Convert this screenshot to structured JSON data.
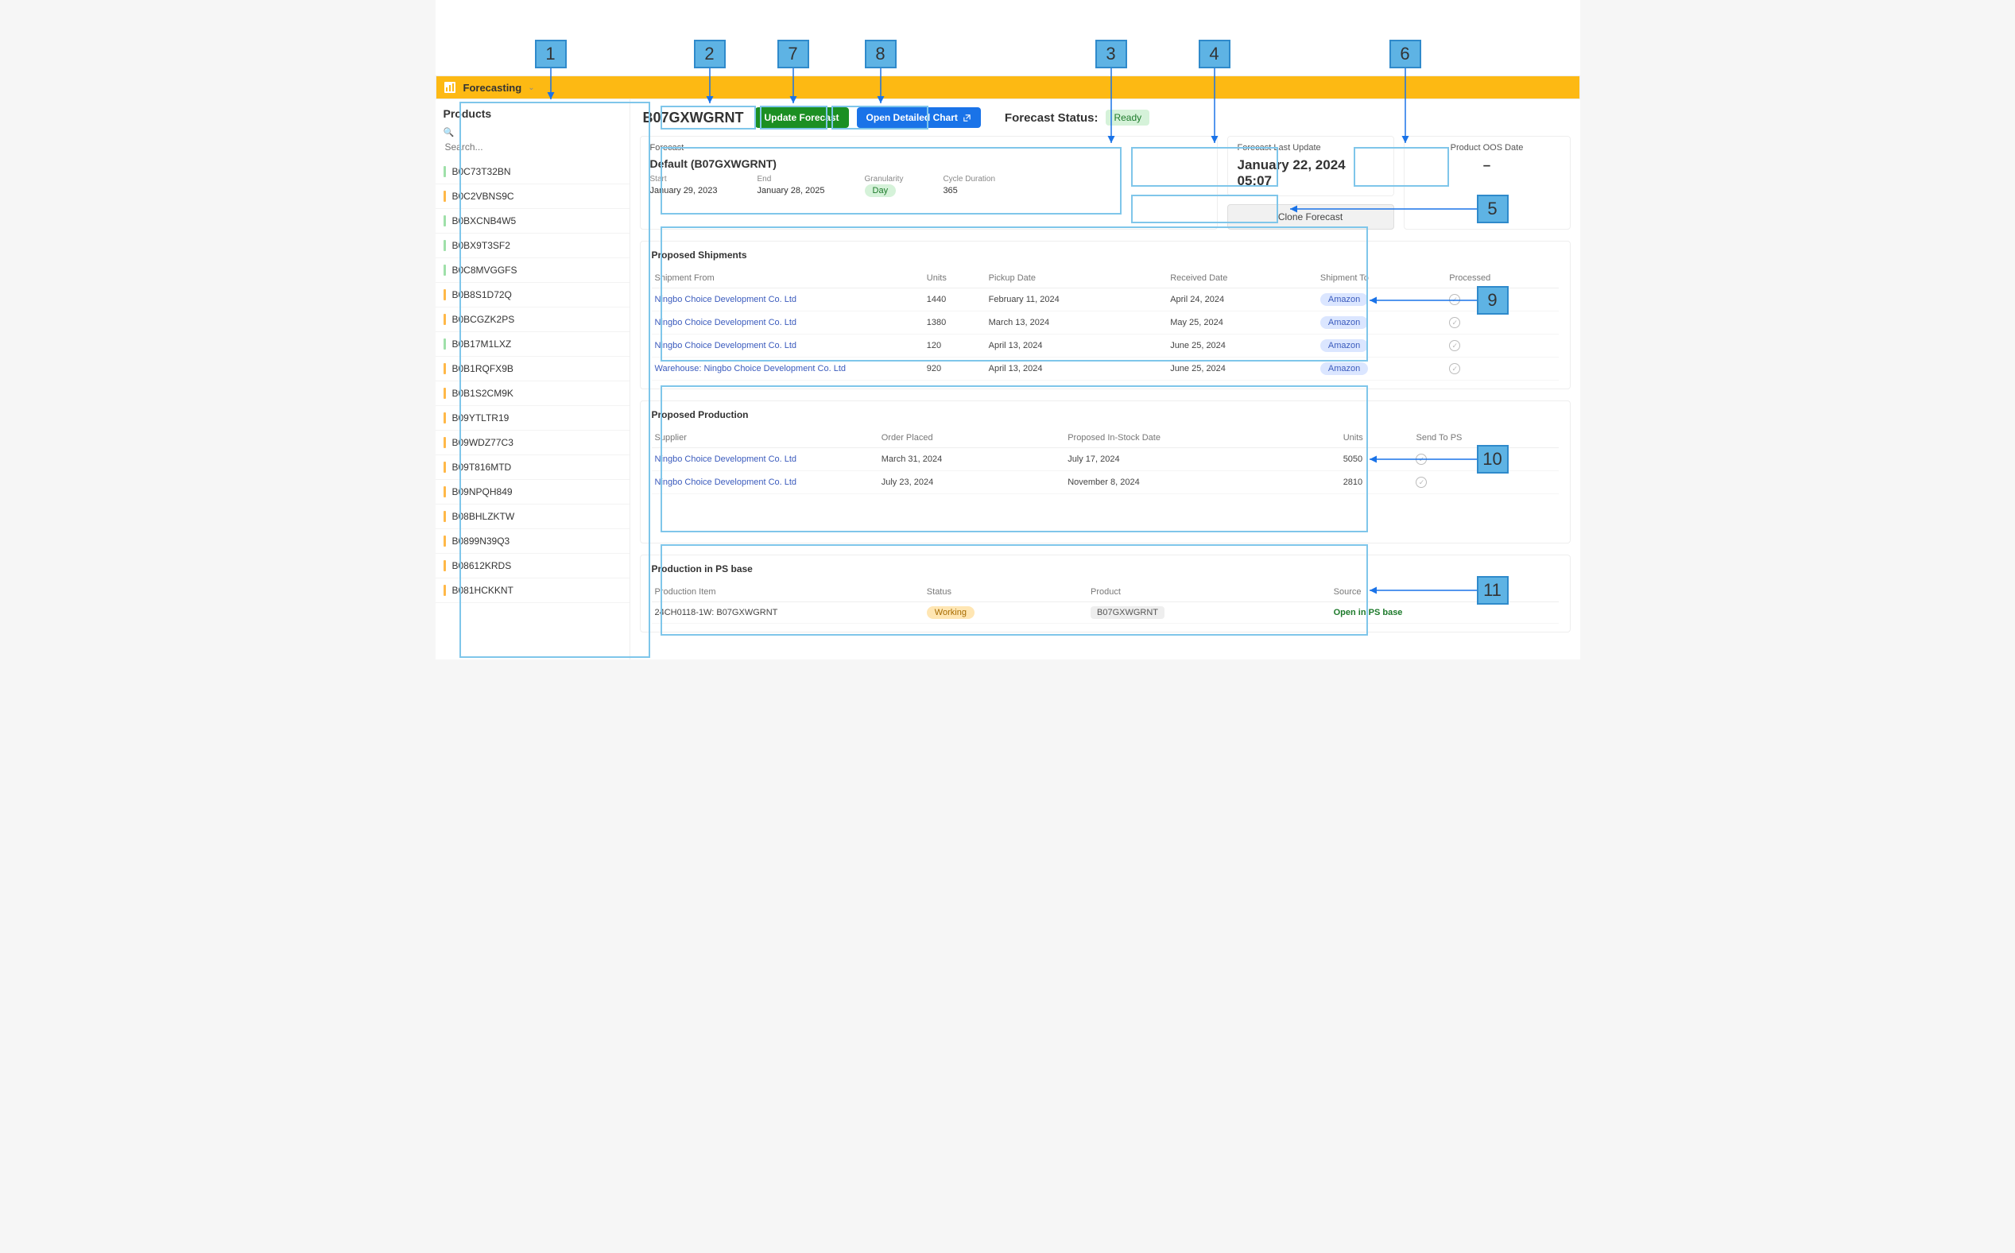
{
  "annotations": {
    "1": "1",
    "2": "2",
    "3": "3",
    "4": "4",
    "5": "5",
    "6": "6",
    "7": "7",
    "8": "8",
    "9": "9",
    "10": "10",
    "11": "11"
  },
  "header": {
    "title": "Forecasting"
  },
  "sidebar": {
    "title": "Products",
    "search_placeholder": "Search...",
    "items": [
      {
        "code": "B0C73T32BN",
        "bar": "green"
      },
      {
        "code": "B0C2VBNS9C",
        "bar": "orange"
      },
      {
        "code": "B0BXCNB4W5",
        "bar": "green"
      },
      {
        "code": "B0BX9T3SF2",
        "bar": "green"
      },
      {
        "code": "B0C8MVGGFS",
        "bar": "green"
      },
      {
        "code": "B0B8S1D72Q",
        "bar": "orange"
      },
      {
        "code": "B0BCGZK2PS",
        "bar": "orange"
      },
      {
        "code": "B0B17M1LXZ",
        "bar": "green"
      },
      {
        "code": "B0B1RQFX9B",
        "bar": "orange"
      },
      {
        "code": "B0B1S2CM9K",
        "bar": "orange"
      },
      {
        "code": "B09YTLTR19",
        "bar": "orange"
      },
      {
        "code": "B09WDZ77C3",
        "bar": "orange"
      },
      {
        "code": "B09T816MTD",
        "bar": "orange"
      },
      {
        "code": "B09NPQH849",
        "bar": "orange"
      },
      {
        "code": "B08BHLZKTW",
        "bar": "orange"
      },
      {
        "code": "B0899N39Q3",
        "bar": "orange"
      },
      {
        "code": "B08612KRDS",
        "bar": "orange"
      },
      {
        "code": "B081HCKKNT",
        "bar": "orange"
      }
    ]
  },
  "toolbar": {
    "sku": "B07GXWGRNT",
    "update_label": "Update Forecast",
    "open_chart_label": "Open Detailed Chart",
    "status_label": "Forecast Status:",
    "status_badge": "Ready"
  },
  "forecast_card": {
    "title": "Forecast",
    "name": "Default (B07GXWGRNT)",
    "start_label": "Start",
    "start": "January 29, 2023",
    "end_label": "End",
    "end": "January 28, 2025",
    "gran_label": "Granularity",
    "gran": "Day",
    "cycle_label": "Cycle Duration",
    "cycle": "365"
  },
  "last_update": {
    "label": "Forecast Last Update",
    "value": "January 22, 2024  05:07"
  },
  "oos": {
    "label": "Product OOS Date",
    "value": "–"
  },
  "clone_label": "Clone Forecast",
  "shipments": {
    "title": "Proposed Shipments",
    "headers": {
      "from": "Shipment From",
      "units": "Units",
      "pickup": "Pickup Date",
      "recv": "Received Date",
      "to": "Shipment To",
      "proc": "Processed"
    },
    "rows": [
      {
        "from": "Ningbo Choice Development Co. Ltd",
        "units": "1440",
        "pickup": "February 11, 2024",
        "recv": "April 24, 2024",
        "to": "Amazon"
      },
      {
        "from": "Ningbo Choice Development Co. Ltd",
        "units": "1380",
        "pickup": "March 13, 2024",
        "recv": "May 25, 2024",
        "to": "Amazon"
      },
      {
        "from": "Ningbo Choice Development Co. Ltd",
        "units": "120",
        "pickup": "April 13, 2024",
        "recv": "June 25, 2024",
        "to": "Amazon"
      },
      {
        "from": "Warehouse: Ningbo Choice Development Co. Ltd",
        "units": "920",
        "pickup": "April 13, 2024",
        "recv": "June 25, 2024",
        "to": "Amazon"
      }
    ]
  },
  "production": {
    "title": "Proposed Production",
    "headers": {
      "supplier": "Supplier",
      "placed": "Order Placed",
      "instock": "Proposed In-Stock Date",
      "units": "Units",
      "send": "Send To PS"
    },
    "rows": [
      {
        "supplier": "Ningbo Choice Development Co. Ltd",
        "placed": "March 31, 2024",
        "instock": "July 17, 2024",
        "units": "5050"
      },
      {
        "supplier": "Ningbo Choice Development Co. Ltd",
        "placed": "July 23, 2024",
        "instock": "November 8, 2024",
        "units": "2810"
      }
    ]
  },
  "psbase": {
    "title": "Production in PS base",
    "headers": {
      "item": "Production Item",
      "status": "Status",
      "product": "Product",
      "source": "Source"
    },
    "rows": [
      {
        "item": "24CH0118-1W: B07GXWGRNT",
        "status": "Working",
        "product": "B07GXWGRNT",
        "source": "Open in PS base"
      }
    ]
  }
}
